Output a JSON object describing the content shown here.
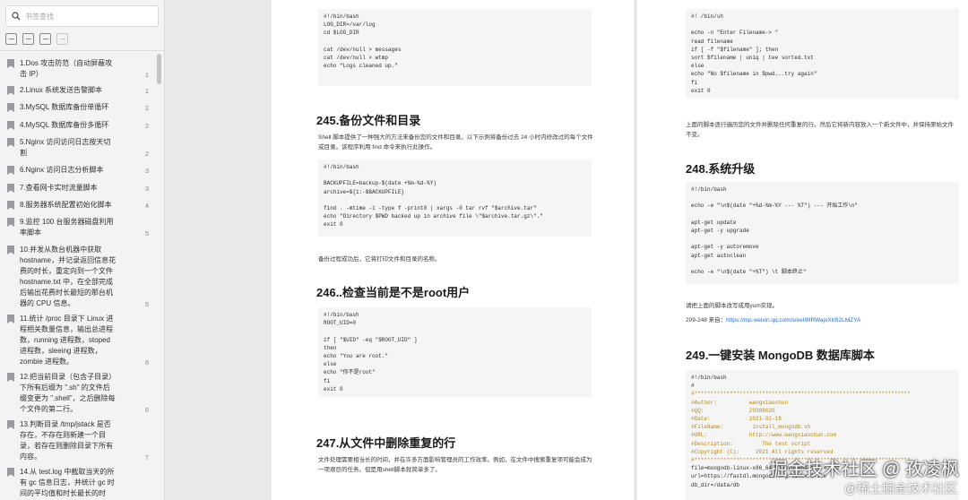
{
  "sidebar": {
    "search_placeholder": "书签查找",
    "bookmarks": [
      {
        "title": "1.Dos 攻击防范（自动屏蔽攻击 IP）",
        "page": "1"
      },
      {
        "title": "2.Linux 系统发送告警脚本",
        "page": "1"
      },
      {
        "title": "3.MySQL 数据库备份单循环",
        "page": "2"
      },
      {
        "title": "4.MySQL 数据库备份多循环",
        "page": "2"
      },
      {
        "title": "5.Nginx 访问访问日志按天切割",
        "page": "2"
      },
      {
        "title": "6.Nginx 访问日志分析脚本",
        "page": "3"
      },
      {
        "title": "7.查看网卡实时流量脚本",
        "page": "3"
      },
      {
        "title": "8.服务器系统配置初始化脚本",
        "page": "4"
      },
      {
        "title": "9.监控 100 台服务器磁盘利用率脚本",
        "page": "5"
      },
      {
        "title": "10.并发从数台机器中获取 hostname，并记录返回信息花费的时长，重定向到一个文件 hostname.txt 中，在全部完成后输出花费时长最短的那台机器的 CPU 信息。",
        "page": "5"
      },
      {
        "title": "11.统计 /proc 目录下 Linux 进程相关数量信息，输出总进程数，running 进程数，stoped 进程数，sleeing 进程数，zombie 进程数。",
        "page": "6"
      },
      {
        "title": "12.把当前目录（包含子目录）下所有后缀为 \".sh\" 的文件后缀变更为 \".shell\"，之后删除每个文件的第二行。",
        "page": "6"
      },
      {
        "title": "13.判断目录 /tmp/jstack 是否存在，不存在则新建一个目录，若存在则删除目录下所有内容。",
        "page": "7"
      },
      {
        "title": "14.从 test.log 中截取当天的所有 gc 信息日志，并统计 gc 时间的平均值和时长最长的时",
        "page": ""
      }
    ]
  },
  "page_left": {
    "code_top": "#!/bin/bash\nLOG_DIR=/var/log\ncd $LOG_DIR\n\ncat /dev/null > messages\ncat /dev/null > wtmp\necho \"Logs cleaned up.\"",
    "h245": "245.备份文件和目录",
    "p245": "Shell 脚本提供了一种强大的方法来备份您的文件和目录。以下示例将备份过去 24 小时内修改过的每个文件或目录。该程序利用 find 命令来执行此操作。",
    "code245": "#!/bin/bash\n\nBACKUPFILE=backup-$(date +%m-%d-%Y)\narchive=${1:-$BACKUPFILE}\n\nfind . -mtime -1 -type f -print0 | xargs -0 tar rvf \"$archive.tar\"\necho \"Directory $PWD backed up in archive file \\\"$archive.tar.gz\\\".\"\nexit 0",
    "after245": "备份过程成功后，它将打印文件和目录的名称。",
    "h246": "246..检查当前是不是root用户",
    "code246": "#!/bin/bash\nROOT_UID=0\n\nif [ \"$UID\" -eq \"$ROOT_UID\" ]\nthen\necho \"You are root.\"\nelse\necho \"你不是root\"\nfi\nexit 0",
    "h247": "247.从文件中删除重复的行",
    "p247": "文件处理需要相当长的时间，并在许多方面影响管理员的工作效率。例如，在文件中搜索重复项可能会成为一项艰巨的任务。但是用shell脚本就简单多了。"
  },
  "page_right": {
    "code_top": "#! /bin/sh\n\necho -n \"Enter Filename-> \"\nread filename\nif [ -f \"$filename\" ]; then\nsort $filename | uniq | tee sorted.txt\nelse\necho \"No $filename in $pwd...try again\"\nfi\nexit 0",
    "p_top": "上面的脚本逐行遍历您的文件并删除任何重复的行。然后它将新内容放入一个新文件中，并保持原始文件不变。",
    "h248": "248.系统升级",
    "code248": "#!/bin/bash\n\necho -e \"\\n$(date \"+%d-%m-%Y --- %T\") --- 开始工作\\n\"\n\napt-get update\napt-get -y upgrade\n\napt-get -y autoremove\napt-get autoclean\n\necho -e \"\\n$(date \"+%T\") \\t 脚本终止\"",
    "p248": "请把上面的脚本改写成用yum实现。",
    "source_label": "209-248 来自：",
    "source_url": "https://mp.weixin.qq.com/s/eeI9lIRWajxXlrB2LMZYA",
    "h249": "249.一键安装 MongoDB 数据库脚本",
    "code249_head": "#!/bin/bash\n#",
    "code249_comment": "#*******************************************************************\n#Author:          wangxiaochun\n#QQ:              29308620\n#Date:            2021-02-19\n#FileName:         install_mongodb.sh\n#URL:             http://www.wangxiaochun.com\n#Description:         The test script\n#Copyright (C):     2021 All rights reserved\n#*******************************************************************",
    "code249_tail": "file=mongodb-linux-x86_64-ubuntu1804-4.4.4.tgz\nurl=https://fastdl.mongodb.org/linux/$file\ndb_dir=/data/db"
  },
  "watermark": {
    "main": "掘金技术社区 @ 孜凌枫",
    "sub": "@稀土掘金技术社区"
  }
}
